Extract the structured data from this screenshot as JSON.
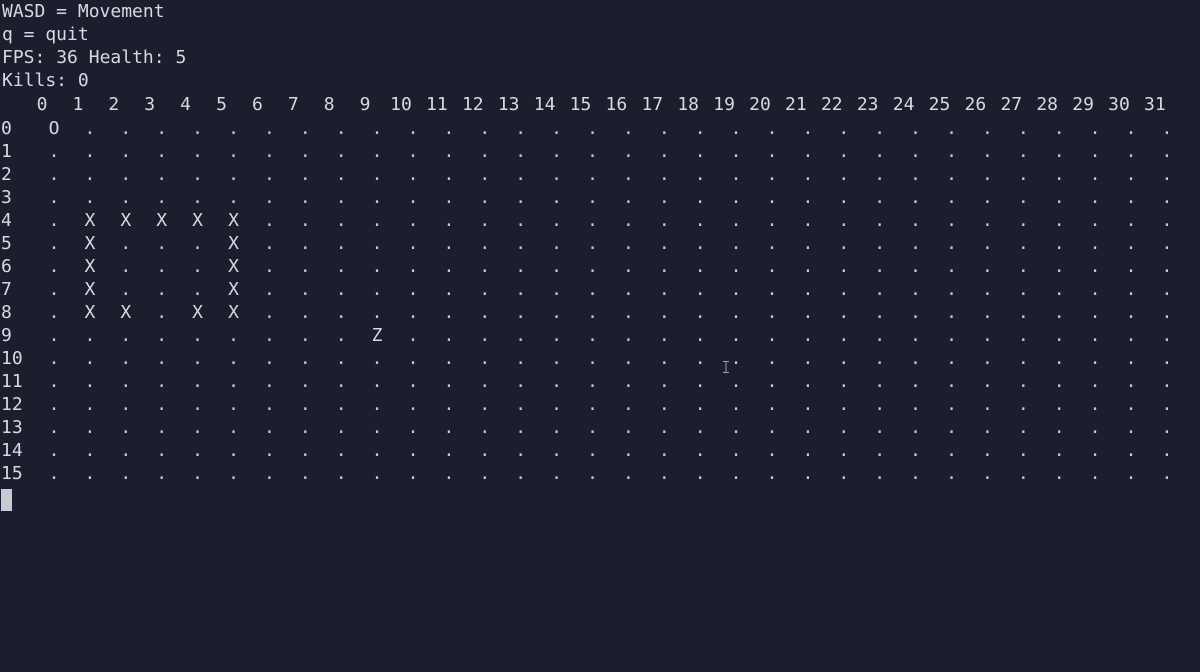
{
  "hud": {
    "line1": "WASD = Movement",
    "line2": "q = quit",
    "fps_label": "FPS:",
    "fps": "36",
    "health_label": "Health:",
    "health": "5",
    "kills_label": "Kills:",
    "kills": "0"
  },
  "grid": {
    "columns": 32,
    "rows": 16,
    "empty_char": ".",
    "player_char": "O",
    "wall_char": "X",
    "zombie_char": "Z",
    "player": [
      0,
      0
    ],
    "zombies": [
      [
        9,
        9
      ]
    ],
    "walls": [
      [
        4,
        1
      ],
      [
        4,
        2
      ],
      [
        4,
        3
      ],
      [
        4,
        4
      ],
      [
        4,
        5
      ],
      [
        5,
        1
      ],
      [
        5,
        5
      ],
      [
        6,
        1
      ],
      [
        6,
        5
      ],
      [
        7,
        1
      ],
      [
        7,
        5
      ],
      [
        8,
        1
      ],
      [
        8,
        2
      ],
      [
        8,
        4
      ],
      [
        8,
        5
      ]
    ]
  },
  "colors": {
    "background": "#1b1f2d",
    "text": "#d5d9e0",
    "cursor": "#c8cbd2"
  }
}
